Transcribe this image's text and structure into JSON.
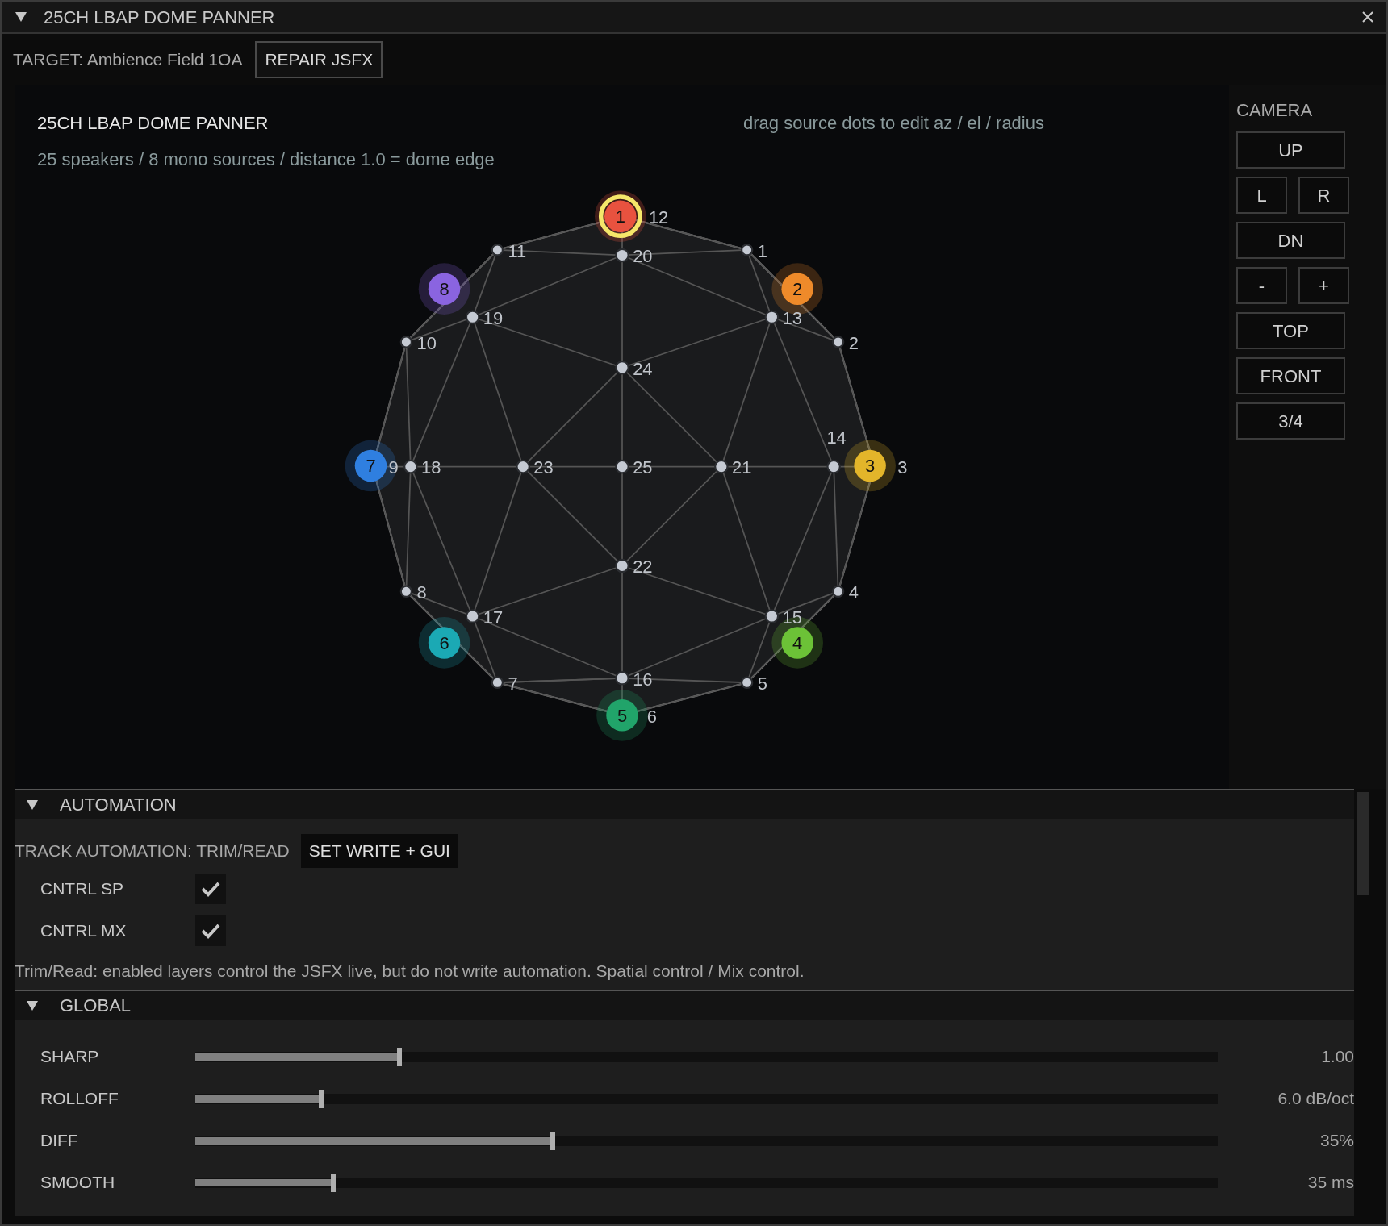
{
  "window": {
    "title": "25CH LBAP DOME PANNER"
  },
  "target": {
    "label": "TARGET: Ambience Field 1OA",
    "button": "REPAIR JSFX"
  },
  "panner": {
    "title": "25CH LBAP DOME PANNER",
    "subtitle": "25 speakers / 8 mono sources / distance 1.0 = dome edge",
    "hint": "drag source dots to edit az / el / radius",
    "speakers": [
      "12",
      "11",
      "1",
      "20",
      "19",
      "13",
      "10",
      "2",
      "24",
      "9",
      "18",
      "23",
      "25",
      "21",
      "14",
      "3",
      "22",
      "8",
      "4",
      "17",
      "15",
      "7",
      "16",
      "5",
      "6"
    ],
    "sources": [
      {
        "label": "1",
        "color": "#e8523f",
        "selected": true
      },
      {
        "label": "8",
        "color": "#8a64e0",
        "selected": false
      },
      {
        "label": "2",
        "color": "#ee8a2a",
        "selected": false
      },
      {
        "label": "7",
        "color": "#2f7fe0",
        "selected": false
      },
      {
        "label": "3",
        "color": "#e3b52a",
        "selected": false
      },
      {
        "label": "6",
        "color": "#1ba9b4",
        "selected": false
      },
      {
        "label": "4",
        "color": "#6cc237",
        "selected": false
      },
      {
        "label": "5",
        "color": "#21a46a",
        "selected": false
      }
    ]
  },
  "camera": {
    "title": "CAMERA",
    "rows": [
      [
        "UP"
      ],
      [
        "L",
        "R"
      ],
      [
        "DN"
      ],
      [
        "-",
        "+"
      ],
      [
        "TOP"
      ],
      [
        "FRONT"
      ],
      [
        "3/4"
      ]
    ]
  },
  "automation": {
    "title": "AUTOMATION",
    "expanded": true,
    "mode": "TRACK AUTOMATION: TRIM/READ",
    "button": "SET WRITE + GUI",
    "layers": [
      {
        "label": "CNTRL SP",
        "checked": true
      },
      {
        "label": "CNTRL MX",
        "checked": true
      }
    ],
    "note": "Trim/Read: enabled layers control the JSFX live, but do not write automation. Spatial control / Mix control."
  },
  "global": {
    "title": "GLOBAL",
    "expanded": true,
    "sliders": [
      {
        "label": "SHARP",
        "level": 0.2,
        "reading": "1.00"
      },
      {
        "label": "ROLLOFF",
        "level": 0.123,
        "reading": "6.0 dB/oct"
      },
      {
        "label": "DIFF",
        "level": 0.35,
        "reading": "35%"
      },
      {
        "label": "SMOOTH",
        "level": 0.135,
        "reading": "35 ms"
      }
    ]
  }
}
